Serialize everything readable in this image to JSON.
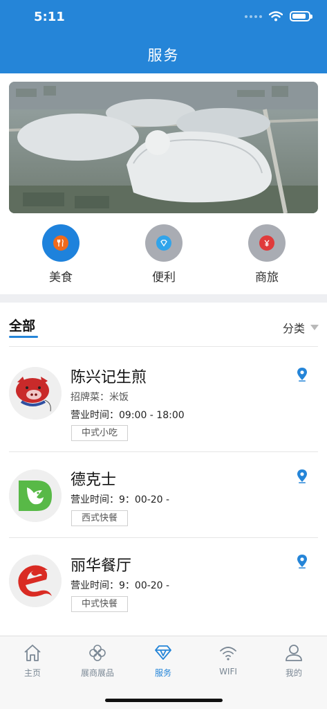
{
  "status_bar": {
    "time": "5:11",
    "battery_level": 0.85
  },
  "header": {
    "title": "服务"
  },
  "banner": {
    "image": "exhibition-center-aerial-photo"
  },
  "categories": [
    {
      "label": "美食",
      "icon": "food-icon",
      "color": "#1e82dc",
      "inner_color": "#f06a1c"
    },
    {
      "label": "便利",
      "icon": "convenience-icon",
      "color": "#a9acb3",
      "inner_color": "#31a4ea"
    },
    {
      "label": "商旅",
      "icon": "business-travel-icon",
      "color": "#a9acb3",
      "inner_color": "#e03a3a"
    }
  ],
  "section": {
    "title": "全部",
    "filter_label": "分类"
  },
  "restaurants": [
    {
      "name": "陈兴记生煎",
      "signature": "招牌菜：米饭",
      "hours": "营业时间：09:00 - 18:00",
      "tag": "中式小吃",
      "logo": "pig-logo-icon"
    },
    {
      "name": "德克士",
      "hours": "营业时间：9：00-20 -",
      "tag": "西式快餐",
      "logo": "dicos-bird-logo-icon"
    },
    {
      "name": "丽华餐厅",
      "hours": "营业时间：9：00-20 -",
      "tag": "中式快餐",
      "logo": "lihua-e-logo-icon"
    }
  ],
  "tabbar": [
    {
      "label": "主页",
      "icon": "home-icon",
      "active": false
    },
    {
      "label": "展商展品",
      "icon": "flower-icon",
      "active": false
    },
    {
      "label": "服务",
      "icon": "diamond-icon",
      "active": true
    },
    {
      "label": "WIFI",
      "icon": "wifi-icon",
      "active": false
    },
    {
      "label": "我的",
      "icon": "user-icon",
      "active": false
    }
  ],
  "colors": {
    "brand": "#2585d8",
    "inactive": "#7a8794"
  }
}
